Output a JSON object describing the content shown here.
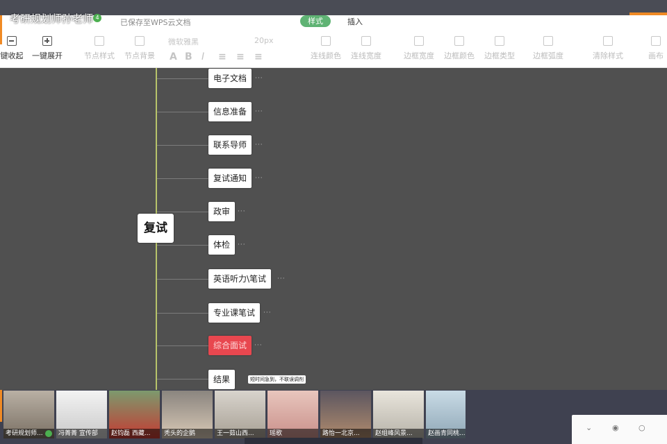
{
  "window": {
    "room_title": "考研规划师孙老师",
    "badge_count": "4"
  },
  "toolbar": {
    "saved_status": "已保存至WPS云文档",
    "tabs": [
      {
        "label": "样式",
        "active": true,
        "color": "#5fb374"
      },
      {
        "label": "插入",
        "active": false
      }
    ],
    "buttons": [
      {
        "label": "键收起",
        "enabled": true
      },
      {
        "label": "一键展开",
        "enabled": true
      },
      {
        "label": "节点样式",
        "enabled": false
      },
      {
        "label": "节点背景",
        "enabled": false
      },
      {
        "label": "连线颜色",
        "enabled": false
      },
      {
        "label": "连线宽度",
        "enabled": false
      },
      {
        "label": "边框宽度",
        "enabled": false
      },
      {
        "label": "边框颜色",
        "enabled": false
      },
      {
        "label": "边框类型",
        "enabled": false
      },
      {
        "label": "边框弧度",
        "enabled": false
      },
      {
        "label": "清除样式",
        "enabled": false
      },
      {
        "label": "画布",
        "enabled": false
      }
    ],
    "font_family": "微软雅黑",
    "font_size": "20px",
    "format_glyphs": [
      "A",
      "B",
      "I"
    ]
  },
  "mindmap": {
    "root": "复试",
    "nodes": [
      {
        "label": "电子文档",
        "highlight": false
      },
      {
        "label": "信息准备",
        "highlight": false
      },
      {
        "label": "联系导师",
        "highlight": false
      },
      {
        "label": "复试通知",
        "highlight": false
      },
      {
        "label": "政审",
        "highlight": false
      },
      {
        "label": "体检",
        "highlight": false
      },
      {
        "label": "英语听力\\笔试",
        "highlight": false
      },
      {
        "label": "专业课笔试",
        "highlight": false
      },
      {
        "label": "综合面试",
        "highlight": true
      },
      {
        "label": "结果",
        "highlight": false
      }
    ],
    "note": "短时间急到，不联误调剂",
    "colors": {
      "spine": "#b8c46a",
      "highlight": "#e8474f"
    }
  },
  "participants": [
    {
      "name": "考研规划师...",
      "mic_on": true
    },
    {
      "name": "冯菁菁 宣传部",
      "mic_on": false
    },
    {
      "name": "赵钧磊 西藏...",
      "mic_on": false
    },
    {
      "name": "秃头的企鹅",
      "mic_on": false
    },
    {
      "name": "王一茹山西...",
      "mic_on": false
    },
    {
      "name": "瑶歌",
      "mic_on": false
    },
    {
      "name": "路怡一北京...",
      "mic_on": false
    },
    {
      "name": "赵组峰风景...",
      "mic_on": false
    },
    {
      "name": "赵画青同桃...",
      "mic_on": false
    }
  ]
}
